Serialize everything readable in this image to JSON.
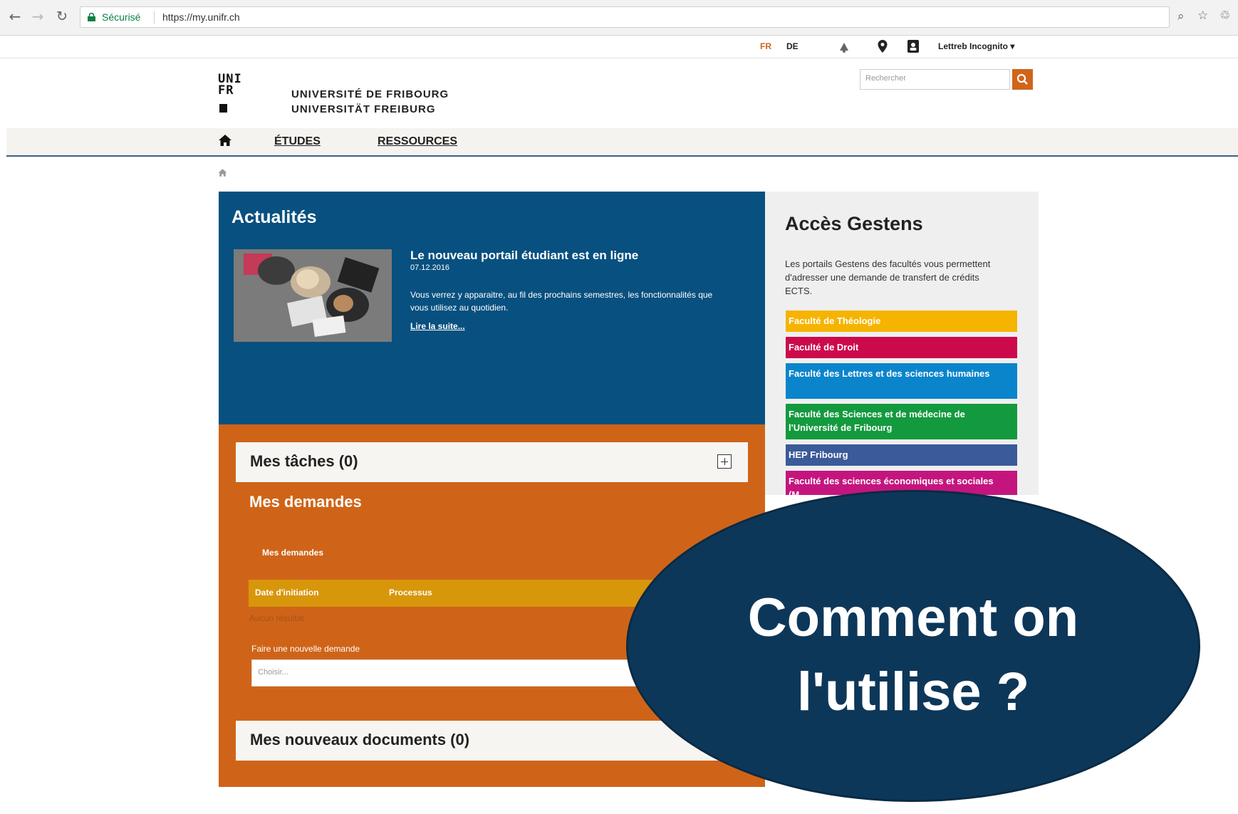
{
  "browser": {
    "secure_label": "Sécurisé",
    "url": "https://my.unifr.ch"
  },
  "topbar": {
    "lang_fr": "FR",
    "lang_de": "DE",
    "user_name": "Lettreb Incognito"
  },
  "header": {
    "logo_text_1": "UNI",
    "logo_text_2": "FR",
    "university_fr": "UNIVERSITÉ DE FRIBOURG",
    "university_de": "UNIVERSITÄT FREIBURG",
    "search_placeholder": "Rechercher"
  },
  "nav": {
    "items": [
      {
        "label": "ÉTUDES"
      },
      {
        "label": "RESSOURCES"
      }
    ]
  },
  "news": {
    "title": "Actualités",
    "headline": "Le nouveau portail étudiant est en ligne",
    "date": "07.12.2016",
    "body": "Vous verrez y apparaitre, au fil des prochains semestres, les fonctionnalités que vous utilisez au quotidien.",
    "read_more": "Lire la suite..."
  },
  "tasks": {
    "title": "Mes tâches (0)"
  },
  "requests": {
    "title": "Mes demandes",
    "subtitle": "Mes demandes",
    "columns": [
      "Date d'initiation",
      "Processus"
    ],
    "empty": "Aucun résultat",
    "new_label": "Faire une nouvelle demande",
    "select_placeholder": "Choisir..."
  },
  "documents": {
    "title": "Mes nouveaux documents (0)"
  },
  "gestens": {
    "title": "Accès Gestens",
    "description": "Les portails Gestens des facultés vous permettent d'adresser une demande de transfert de crédits ECTS.",
    "faculties": [
      {
        "label": "Faculté de Théologie",
        "color": "#f5b400"
      },
      {
        "label": "Faculté de Droit",
        "color": "#cc0a4b"
      },
      {
        "label": "Faculté des Lettres et des sciences humaines",
        "color": "#0a85cc"
      },
      {
        "label": "Faculté des Sciences et de médecine de l'Université de Fribourg",
        "color": "#139a3e"
      },
      {
        "label": "HEP Fribourg",
        "color": "#3b5a99"
      },
      {
        "label": "Faculté des sciences économiques et sociales (M...",
        "color": "#c4157e"
      }
    ]
  },
  "overlay": {
    "line1": "Comment on",
    "line2": "l'utilise ?"
  },
  "colors": {
    "news_bg": "#08507f",
    "orange_bg": "#cf6418",
    "table_head": "#d8960b",
    "bubble": "#0d3759"
  }
}
